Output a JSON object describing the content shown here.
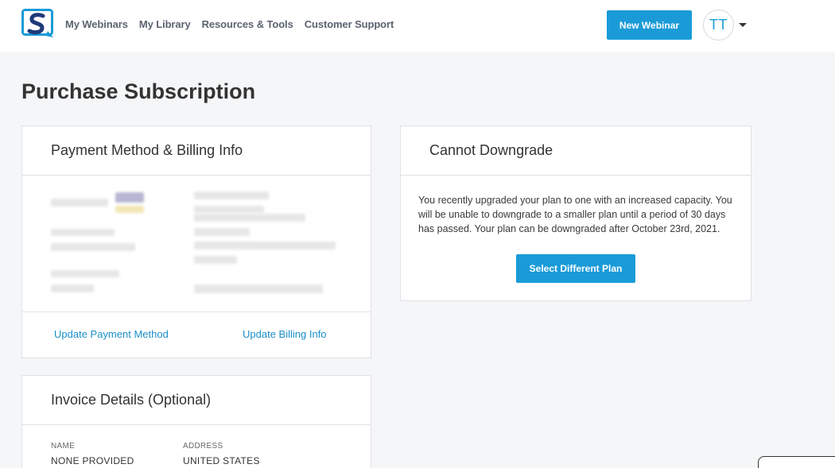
{
  "nav": {
    "items": [
      "My Webinars",
      "My Library",
      "Resources & Tools",
      "Customer Support"
    ],
    "new_webinar_label": "New Webinar",
    "avatar_initials": "TT"
  },
  "page": {
    "title": "Purchase Subscription"
  },
  "payment_card": {
    "title": "Payment Method & Billing Info",
    "update_payment_label": "Update Payment Method",
    "update_billing_label": "Update Billing Info"
  },
  "downgrade_card": {
    "title": "Cannot Downgrade",
    "message": "You recently upgraded your plan to one with an increased capacity. You will be unable to downgrade to a smaller plan until a period of 30 days has passed. Your plan can be downgraded after October 23rd, 2021.",
    "button_label": "Select Different Plan"
  },
  "invoice_card": {
    "title": "Invoice Details (Optional)",
    "name_label": "NAME",
    "name_value": "NONE PROVIDED",
    "address_label": "ADDRESS",
    "address_value": "UNITED STATES"
  },
  "colors": {
    "accent": "#1a9bd7",
    "link": "#1a8fc9",
    "background": "#f5f6f8"
  }
}
